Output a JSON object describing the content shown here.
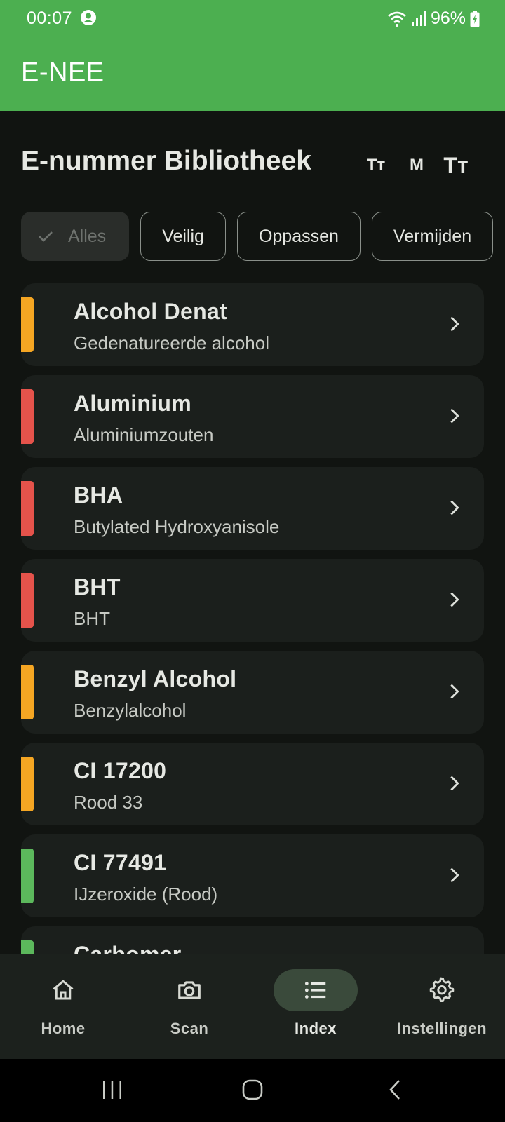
{
  "status_bar": {
    "time": "00:07",
    "battery": "96%"
  },
  "app_bar": {
    "title": "E-NEE"
  },
  "header": {
    "title": "E-nummer Bibliotheek",
    "font_small": "Tт",
    "font_medium": "M",
    "font_large": "Tт"
  },
  "filters": [
    {
      "label": "Alles",
      "selected": true
    },
    {
      "label": "Veilig",
      "selected": false
    },
    {
      "label": "Oppassen",
      "selected": false
    },
    {
      "label": "Vermijden",
      "selected": false
    }
  ],
  "colors": {
    "safe": "#5cb85c",
    "caution": "#f5a623",
    "avoid": "#e5534b",
    "brand": "#4caf50"
  },
  "items": [
    {
      "name": "Alcohol Denat",
      "subtitle": "Gedenatureerde alcohol",
      "level": "caution"
    },
    {
      "name": "Aluminium",
      "subtitle": "Aluminiumzouten",
      "level": "avoid"
    },
    {
      "name": "BHA",
      "subtitle": "Butylated Hydroxyanisole",
      "level": "avoid"
    },
    {
      "name": "BHT",
      "subtitle": "BHT",
      "level": "avoid"
    },
    {
      "name": "Benzyl Alcohol",
      "subtitle": "Benzylalcohol",
      "level": "caution"
    },
    {
      "name": "CI 17200",
      "subtitle": "Rood 33",
      "level": "caution"
    },
    {
      "name": "CI 77491",
      "subtitle": "IJzeroxide (Rood)",
      "level": "safe"
    },
    {
      "name": "Carbomer",
      "subtitle": "",
      "level": "safe"
    }
  ],
  "bottom_nav": [
    {
      "label": "Home",
      "icon": "home-icon",
      "active": false
    },
    {
      "label": "Scan",
      "icon": "camera-icon",
      "active": false
    },
    {
      "label": "Index",
      "icon": "list-icon",
      "active": true
    },
    {
      "label": "Instellingen",
      "icon": "gear-icon",
      "active": false
    }
  ]
}
